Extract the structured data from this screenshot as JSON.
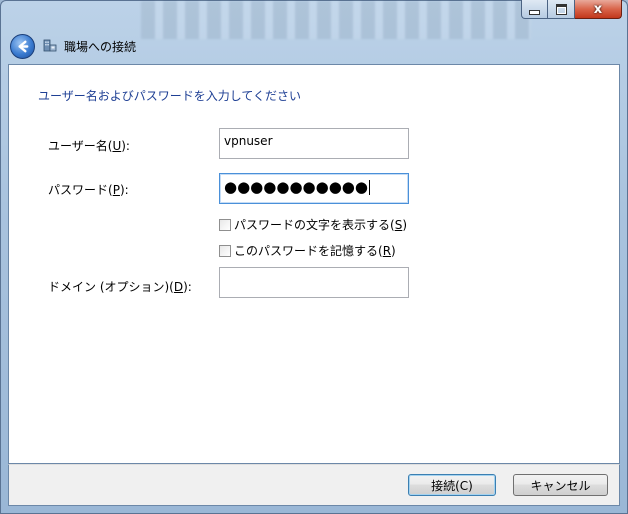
{
  "window": {
    "title": "職場への接続",
    "caption": {
      "close": "x"
    }
  },
  "instruction": "ユーザー名およびパスワードを入力してください",
  "fields": {
    "username_label": "ユーザー名(",
    "username_access": "U",
    "username_value": "vpnuser",
    "password_label": "パスワード(",
    "password_access": "P",
    "password_mask": "●●●●●●●●●●●",
    "domain_label": "ドメイン (オプション)(",
    "domain_access": "D",
    "domain_value": ""
  },
  "checkboxes": {
    "show_chars_label": "パスワードの文字を表示する(",
    "show_chars_access": "S",
    "remember_label": "このパスワードを記憶する(",
    "remember_access": "R"
  },
  "buttons": {
    "connect": "接続(C)",
    "cancel": "キャンセル"
  },
  "colors": {
    "instruction": "#1e3f94",
    "close_button": "#d9654b",
    "default_button_border": "#3c7fb1"
  }
}
